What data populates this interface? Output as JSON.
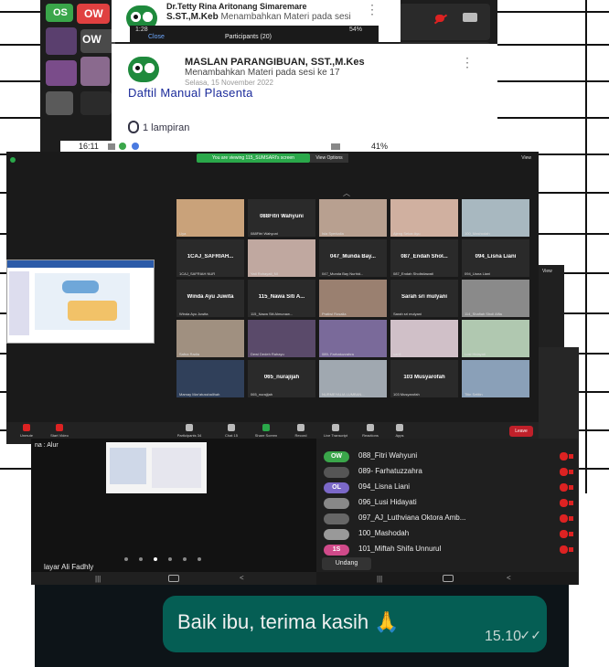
{
  "notif_top": {
    "name": "Dr.Tetty Rina Aritonang Simaremare",
    "line2": "S.ST.,M.Keb",
    "action": "Menambahkan Materi pada sesi",
    "dots": "⋮"
  },
  "phone_status_top": {
    "time": "1:28",
    "close": "Close",
    "participants": "Participants (20)",
    "battery": "54%"
  },
  "tile_badges": [
    "OS",
    "OW"
  ],
  "notif_main": {
    "name": "MASLAN PARANGIBUAN, SST.,M.Kes",
    "action": "Menambahkan Materi pada sesi ke 17",
    "date": "Selasa, 15 November 2022",
    "title": "Daftil Manual Plasenta",
    "attachments": "1 lampiran",
    "dots": "⋮"
  },
  "status_bottom": {
    "time": "16:11",
    "battery": "41%"
  },
  "zoom": {
    "banner": "You are viewing 115_SUMSARI's screen",
    "view_options": "View Options",
    "view": "View",
    "tiles": [
      {
        "name": "",
        "caption": "Liya"
      },
      {
        "name": "088Fitri Wahyuni",
        "caption": "088Fitri Wahyuni"
      },
      {
        "name": "",
        "caption": "Isla Syerkalia"
      },
      {
        "name": "",
        "caption": "Ajeng Sekar Ayu"
      },
      {
        "name": "",
        "caption": "100_Mashodah"
      },
      {
        "name": "1CAJ_SAFRIAH...",
        "caption": "1CAJ_SAFRIAH NUR"
      },
      {
        "name": "",
        "caption": "Yati Rohayati_NI"
      },
      {
        "name": "047_Munda Bay...",
        "caption": "047_Munda Bay Nurhid..."
      },
      {
        "name": "087_Endah Shol...",
        "caption": "087_Endah Sholistiawati"
      },
      {
        "name": "094_Lisna Liani",
        "caption": "094_Lisna Liani"
      },
      {
        "name": "Winda Ayu Juwita",
        "caption": "Winda Ayu Juwita"
      },
      {
        "name": "115_Nawa Siti A...",
        "caption": "115_Nawa Siti Almunaw..."
      },
      {
        "name": "",
        "caption": "Pratiwi Rosalia"
      },
      {
        "name": "Sarah sri mulyani",
        "caption": "Sarah sri mulyani"
      },
      {
        "name": "",
        "caption": "114_Shafiah Sholi Alfia"
      },
      {
        "name": "",
        "caption": "Safna Radia"
      },
      {
        "name": "",
        "caption": "Dewi Dedeh Rahayu"
      },
      {
        "name": "",
        "caption": "089- Farhatuzzahra"
      },
      {
        "name": "",
        "caption": "sanfi"
      },
      {
        "name": "",
        "caption": "Lusi Hidayati"
      },
      {
        "name": "",
        "caption": "Mamay Mar'atusshalihah"
      },
      {
        "name": "065_nurajijah",
        "caption": "065_nurajijah"
      },
      {
        "name": "",
        "caption": "NURMEYALIA LUMBAN..."
      },
      {
        "name": "103 Musyarofah",
        "caption": "103 Musyarofah"
      },
      {
        "name": "",
        "caption": "Titin Setitin"
      }
    ],
    "toolbar": [
      {
        "label": "Unmute"
      },
      {
        "label": "Start Video"
      },
      {
        "label": "Participants",
        "count": "34"
      },
      {
        "label": "Chat",
        "count": "15"
      },
      {
        "label": "Share Screen"
      },
      {
        "label": "Record"
      },
      {
        "label": "Live Transcript"
      },
      {
        "label": "Reactions"
      },
      {
        "label": "Apps"
      }
    ],
    "leave": "Leave"
  },
  "view_right": "View",
  "phone_share": {
    "label_top": "na : Alur",
    "label_bottom": "layar Ali Fadhly"
  },
  "participants": [
    {
      "badge": "OW",
      "color": "#3aa64a",
      "name": "088_Fitri Wahyuni"
    },
    {
      "badge": "",
      "color": "#555555",
      "name": "089- Farhatuzzahra"
    },
    {
      "badge": "OL",
      "color": "#7b68c8",
      "name": "094_Lisna Liani"
    },
    {
      "badge": "",
      "color": "#888888",
      "name": "096_Lusi Hidayati"
    },
    {
      "badge": "",
      "color": "#666666",
      "name": "097_AJ_Luthviana Oktora Amb..."
    },
    {
      "badge": "",
      "color": "#999999",
      "name": "100_Mashodah"
    },
    {
      "badge": "1S",
      "color": "#d04a8a",
      "name": "101_Miftah Shifa Unnurul"
    }
  ],
  "undang": "Undang",
  "whatsapp": {
    "message": "Baik ibu, terima kasih 🙏",
    "time": "15.10",
    "ticks": "✓✓"
  }
}
